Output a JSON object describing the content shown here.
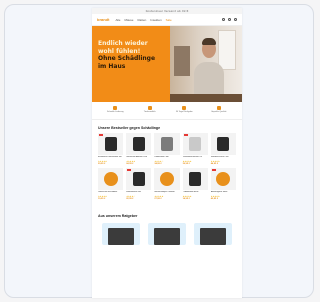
{
  "site": {
    "topbar_text": "Kostenloser Versand ab 49 €",
    "logo": "brandt",
    "nav": [
      {
        "label": "Alle"
      },
      {
        "label": "Mäuse"
      },
      {
        "label": "Ratten"
      },
      {
        "label": "Insekten"
      },
      {
        "label": "Sale"
      }
    ]
  },
  "hero": {
    "line1": "Endlich wieder",
    "line2": "wohl fühlen!",
    "line3": "Ohne Schädlinge",
    "line4": "im Haus"
  },
  "usps": [
    {
      "text": "Schnelle Lieferung"
    },
    {
      "text": "Tierfreundlich"
    },
    {
      "text": "30 Tage Rückgabe"
    },
    {
      "text": "Geprüfte Qualität"
    }
  ],
  "products_section": {
    "title": "Unsere Bestseller gegen Schädlinge",
    "items": [
      {
        "name": "Elektrische Mausefalle Set",
        "price": "29,95 €",
        "stars": "★★★★★",
        "tone": "dark"
      },
      {
        "name": "Ultraschall Abwehr Duo",
        "price": "24,95 €",
        "stars": "★★★★★",
        "tone": "dark"
      },
      {
        "name": "Rattenfalle Profi",
        "price": "34,95 €",
        "stars": "★★★★☆",
        "tone": "grey"
      },
      {
        "name": "Insektenvernichter UV",
        "price": "39,95 €",
        "stars": "★★★★★",
        "tone": "light"
      },
      {
        "name": "Marderschreck Plus",
        "price": "44,95 €",
        "stars": "★★★★★",
        "tone": "dark"
      },
      {
        "name": "Ultraschall Steckdose",
        "price": "19,95 €",
        "stars": "★★★★★",
        "tone": "orange"
      },
      {
        "name": "Köderstation Set",
        "price": "22,95 €",
        "stars": "★★★★☆",
        "tone": "dark"
      },
      {
        "name": "Mückenlampe Outdoor",
        "price": "27,95 €",
        "stars": "★★★★★",
        "tone": "orange"
      },
      {
        "name": "Lebendfalle Maus",
        "price": "14,95 €",
        "stars": "★★★★★",
        "tone": "dark"
      },
      {
        "name": "Abwehrgerät Solar",
        "price": "49,95 €",
        "stars": "★★★★★",
        "tone": "orange"
      }
    ]
  },
  "guides_section": {
    "title": "Aus unserem Ratgeber"
  },
  "colors": {
    "accent": "#f28c17",
    "price": "#e8901b",
    "sale": "#e53935",
    "guide_bg": "#dff0fb"
  }
}
